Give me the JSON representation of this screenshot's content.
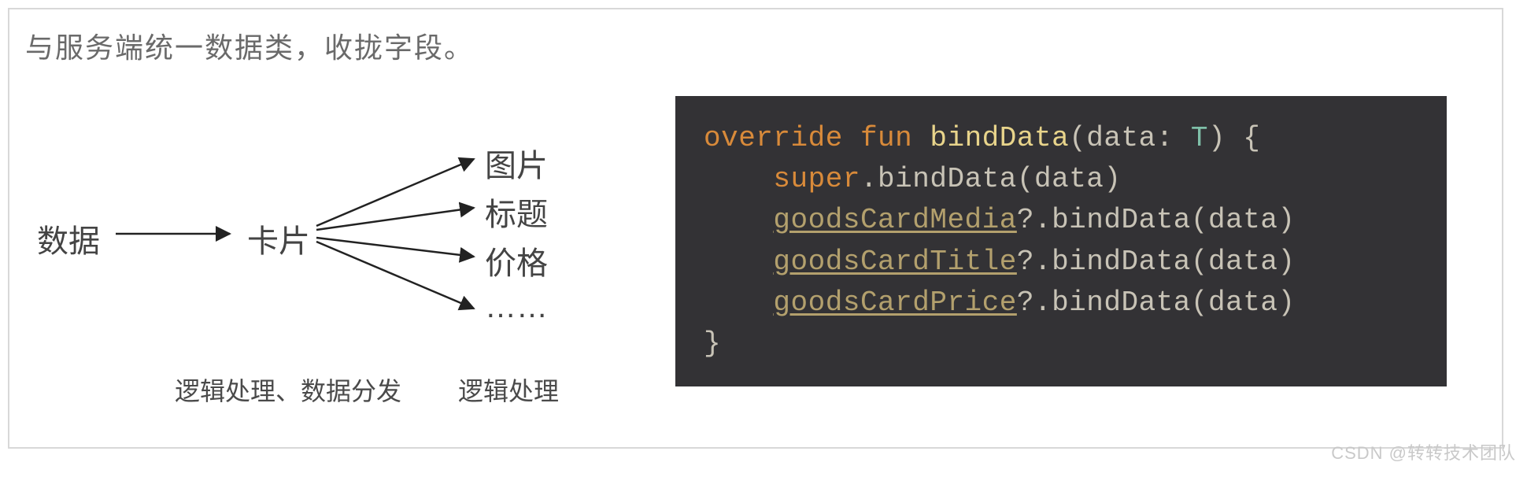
{
  "heading": "与服务端统一数据类，收拢字段。",
  "diagram": {
    "source": "数据",
    "hub": "卡片",
    "targets": [
      "图片",
      "标题",
      "价格",
      "……"
    ],
    "caption_left": "逻辑处理、数据分发",
    "caption_right": "逻辑处理"
  },
  "code": {
    "l1_kw1": "override",
    "l1_kw2": "fun",
    "l1_fn": "bindData",
    "l1_open": "(data: ",
    "l1_ty": "T",
    "l1_close": ") {",
    "l2_kw": "super",
    "l2_rest": ".bindData(data)",
    "l3_id": "goodsCardMedia",
    "l3_rest": "?.bindData(data)",
    "l4_id": "goodsCardTitle",
    "l4_rest": "?.bindData(data)",
    "l5_id": "goodsCardPrice",
    "l5_rest": "?.bindData(data)",
    "l6": "}"
  },
  "watermark": "CSDN @转转技术团队"
}
